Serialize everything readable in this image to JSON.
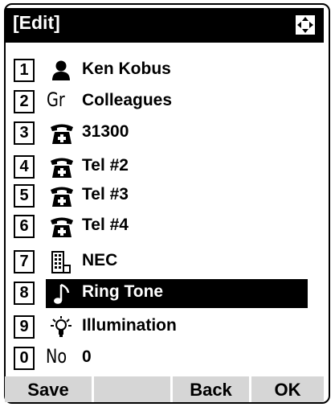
{
  "header": {
    "title": "[Edit]",
    "nav_icon": "four-way-navigation-icon"
  },
  "items": [
    {
      "key": "1",
      "icon": "person-icon",
      "icon_text": "",
      "label": "Ken Kobus"
    },
    {
      "key": "2",
      "icon": "group-icon",
      "icon_text": "Gr",
      "label": "Colleagues"
    },
    {
      "key": "3",
      "icon": "telephone-icon",
      "icon_text": "",
      "label": "31300"
    },
    {
      "key": "4",
      "icon": "telephone-icon",
      "icon_text": "",
      "label": "Tel #2"
    },
    {
      "key": "5",
      "icon": "telephone-icon",
      "icon_text": "",
      "label": "Tel #3"
    },
    {
      "key": "6",
      "icon": "telephone-icon",
      "icon_text": "",
      "label": "Tel #4"
    },
    {
      "key": "7",
      "icon": "building-icon",
      "icon_text": "",
      "label": "NEC"
    },
    {
      "key": "8",
      "icon": "music-note-icon",
      "icon_text": "",
      "label": "Ring Tone",
      "selected": true
    },
    {
      "key": "9",
      "icon": "light-bulb-icon",
      "icon_text": "",
      "label": "Illumination"
    },
    {
      "key": "0",
      "icon": "number-icon",
      "icon_text": "No",
      "label": "0"
    }
  ],
  "softkeys": {
    "save": "Save",
    "blank": "",
    "back": "Back",
    "ok": "OK"
  }
}
